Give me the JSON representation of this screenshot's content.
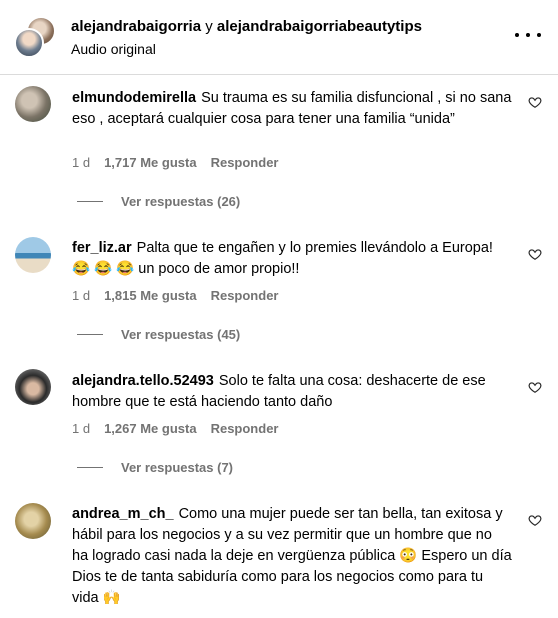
{
  "header": {
    "user1": "alejandrabaigorria",
    "joiner": "y",
    "user2": "alejandrabaigorriabeautytips",
    "audio": "Audio original"
  },
  "comments": [
    {
      "user": "elmundodemirella",
      "text": "Su trauma es su familia disfuncional , si no sana eso , aceptará cualquier cosa para tener una familia “unida”",
      "time": "1 d",
      "likes": "1,717 Me gusta",
      "reply": "Responder",
      "replies": "Ver respuestas (26)"
    },
    {
      "user": "fer_liz.ar",
      "text": "Palta que te engañen y lo premies llevándolo a Europa! 😂 😂 😂 un poco de amor propio!!",
      "time": "1 d",
      "likes": "1,815 Me gusta",
      "reply": "Responder",
      "replies": "Ver respuestas (45)"
    },
    {
      "user": "alejandra.tello.52493",
      "text": "Solo te falta una cosa: deshacerte de ese hombre que te está haciendo tanto daño",
      "time": "1 d",
      "likes": "1,267 Me gusta",
      "reply": "Responder",
      "replies": "Ver respuestas (7)"
    },
    {
      "user": "andrea_m_ch_",
      "text": "Como una mujer puede ser tan bella, tan exitosa y hábil para los negocios y a su vez permitir que un hombre que no ha logrado casi nada la deje en vergüenza pública 😳 Espero un día Dios te de tanta sabiduría como para los negocios como para tu vida 🙌"
    }
  ]
}
